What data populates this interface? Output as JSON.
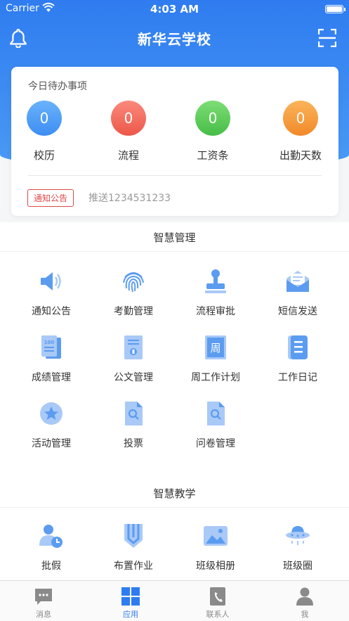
{
  "status": {
    "carrier": "Carrier",
    "time": "4:03 AM"
  },
  "nav": {
    "title": "新华云学校"
  },
  "todo": {
    "title": "今日待办事项",
    "stats": [
      {
        "value": "0",
        "label": "校历",
        "color": "#4a9df6"
      },
      {
        "value": "0",
        "label": "流程",
        "color": "#f06c5c"
      },
      {
        "value": "0",
        "label": "工资条",
        "color": "#5cc95c"
      },
      {
        "value": "0",
        "label": "出勤天数",
        "color": "#f59a3a"
      }
    ],
    "notice_tag": "通知公告",
    "notice_text": "推送1234531233"
  },
  "smart_management": {
    "title": "智慧管理",
    "items": [
      {
        "label": "通知公告",
        "icon": "speaker-icon"
      },
      {
        "label": "考勤管理",
        "icon": "fingerprint-icon"
      },
      {
        "label": "流程审批",
        "icon": "stamp-icon"
      },
      {
        "label": "短信发送",
        "icon": "mail-icon"
      },
      {
        "label": "成绩管理",
        "icon": "score-sheet-icon"
      },
      {
        "label": "公文管理",
        "icon": "document-icon"
      },
      {
        "label": "周工作计划",
        "icon": "weekly-plan-icon"
      },
      {
        "label": "工作日记",
        "icon": "notebook-icon"
      },
      {
        "label": "活动管理",
        "icon": "star-badge-icon"
      },
      {
        "label": "投票",
        "icon": "vote-icon"
      },
      {
        "label": "问卷管理",
        "icon": "questionnaire-icon"
      }
    ]
  },
  "smart_teaching": {
    "title": "智慧教学",
    "items": [
      {
        "label": "批假",
        "icon": "leave-icon"
      },
      {
        "label": "布置作业",
        "icon": "homework-icon"
      },
      {
        "label": "班级相册",
        "icon": "album-icon"
      },
      {
        "label": "班级圈",
        "icon": "planet-icon"
      }
    ]
  },
  "tabs": [
    {
      "label": "消息",
      "icon": "message-icon"
    },
    {
      "label": "应用",
      "icon": "apps-icon"
    },
    {
      "label": "联系人",
      "icon": "contacts-icon"
    },
    {
      "label": "我",
      "icon": "profile-icon"
    }
  ],
  "colors": {
    "primary": "#2f7cf0",
    "icon_blue": "#5b9cf0",
    "icon_light": "#a9c9f7"
  }
}
